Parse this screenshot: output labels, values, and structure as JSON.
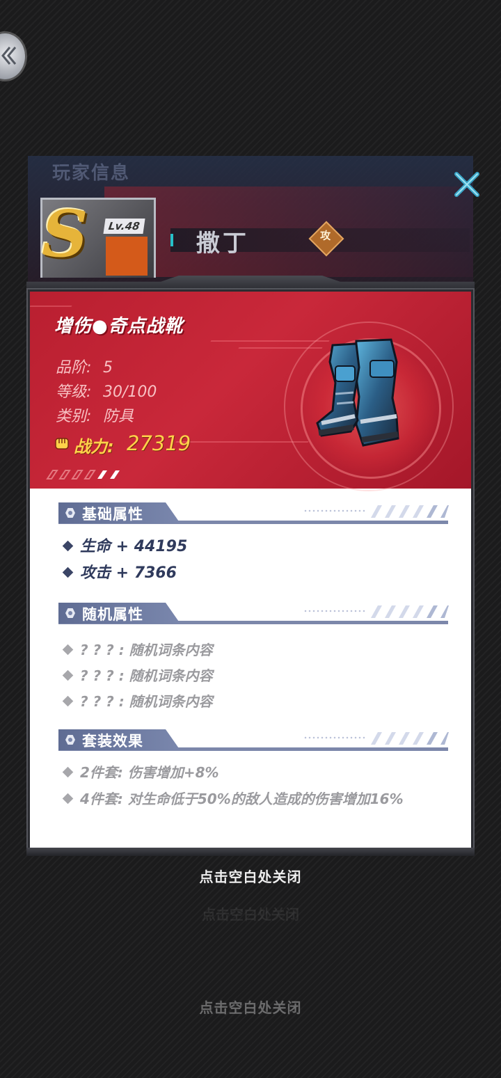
{
  "background": {
    "panel_title": "玩家信息",
    "hero_rank": "S",
    "hero_level": "Lv.48",
    "hero_name": "撒丁",
    "hero_class": "攻"
  },
  "item": {
    "name": "增伤●奇点战靴",
    "stats": [
      {
        "label": "品阶:",
        "value": "5"
      },
      {
        "label": "等级:",
        "value": "30/100"
      },
      {
        "label": "类别:",
        "value": "防具"
      }
    ],
    "power_label": "战力:",
    "power_value": "27319"
  },
  "sections": {
    "base": {
      "title": "基础属性",
      "attrs": [
        "生命 + 44195",
        "攻击 + 7366"
      ]
    },
    "random": {
      "title": "随机属性",
      "attrs": [
        "? ? ? : 随机词条内容",
        "? ? ? : 随机词条内容",
        "? ? ? : 随机词条内容"
      ]
    },
    "set": {
      "title": "套装效果",
      "attrs": [
        "2件套: 伤害增加+8%",
        "4件套: 对生命低于50%的敌人造成的伤害增加16%"
      ]
    }
  },
  "close_hint": "点击空白处关闭",
  "colors": {
    "header_red": "#c9283a",
    "power_gold": "#ffd24a",
    "section_blue": "#6f7ba2"
  }
}
